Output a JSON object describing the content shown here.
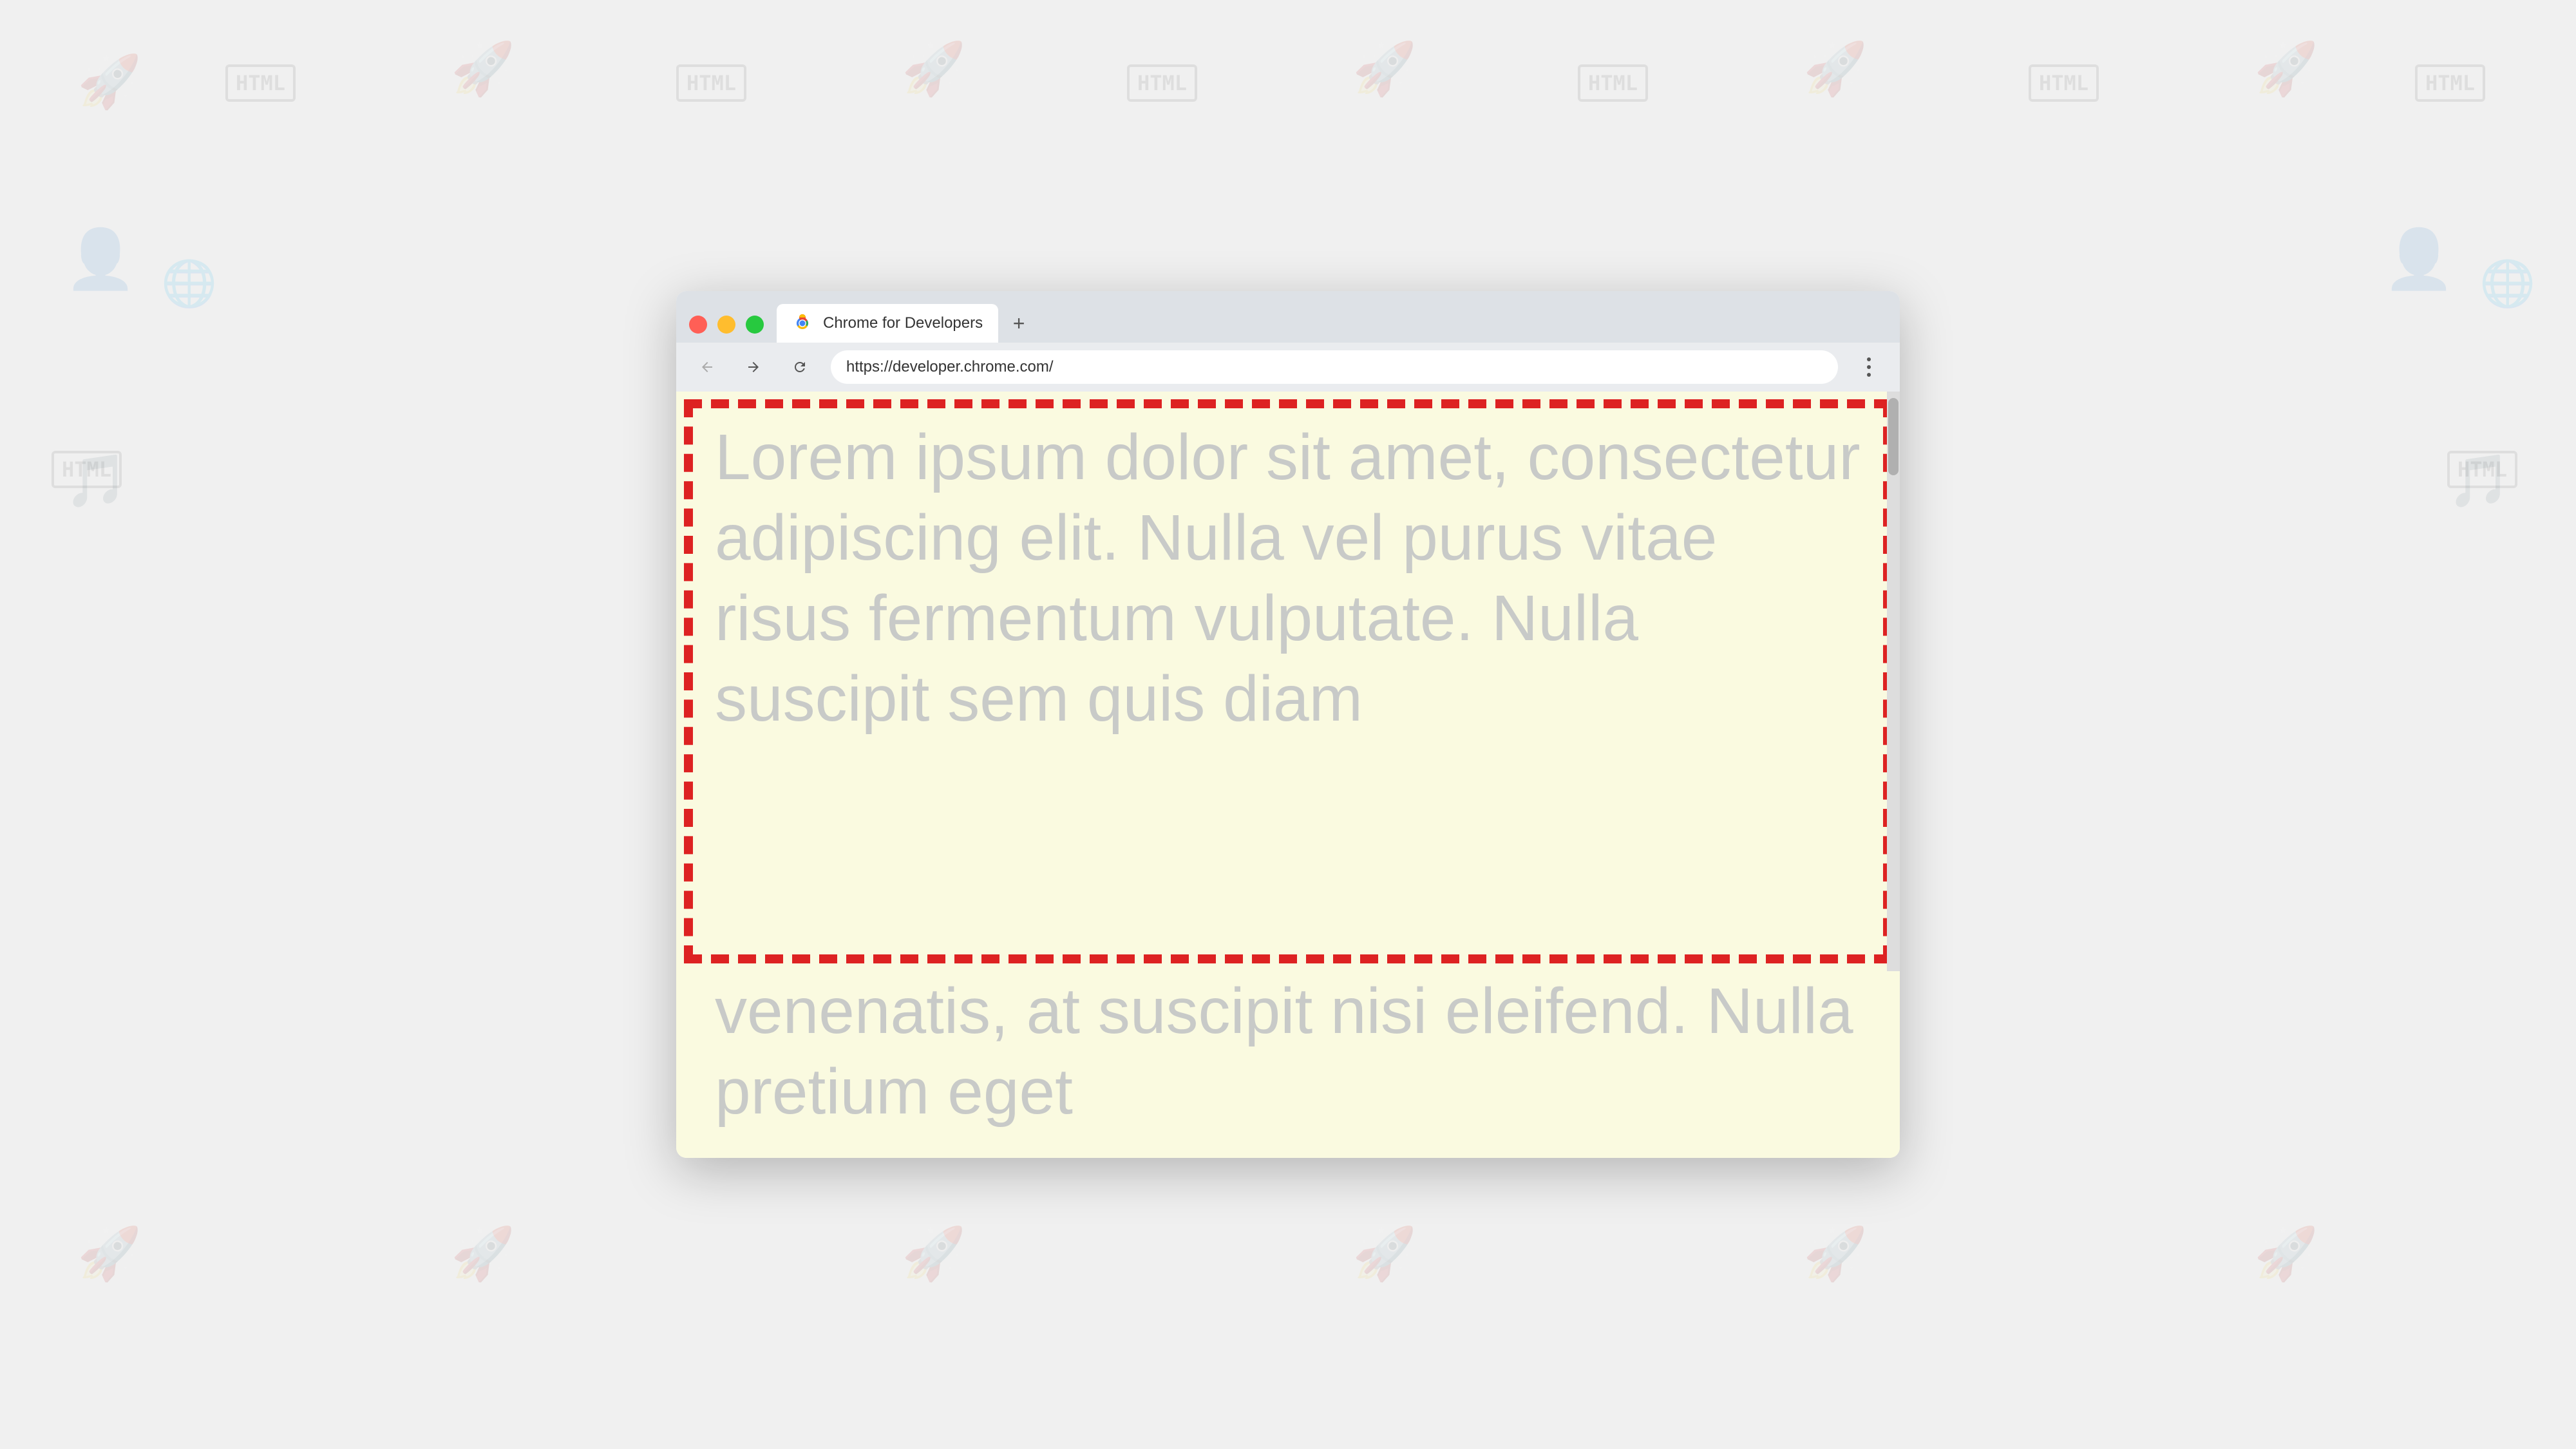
{
  "browser": {
    "tab": {
      "title": "Chrome for Developers",
      "url": "https://developer.chrome.com/",
      "favicon_alt": "Chrome logo"
    },
    "new_tab_label": "+",
    "nav": {
      "back_label": "←",
      "forward_label": "→",
      "refresh_label": "↻"
    },
    "menu_label": "⋮"
  },
  "page": {
    "lorem_text": "Lorem ipsum dolor sit amet, consectetur adipiscing elit. Nulla vel purus vitae risus fermentum vulputate. Nulla suscipit sem quis diam venenatis, at suscipit nisi eleifend. Nulla pretium eget",
    "below_fold_text": "venenatis, at suscipit nisi eleifend. Nulla pretium eget",
    "background_color": "#fafae0",
    "border_color": "#dd2222"
  },
  "background_icons": {
    "html_label": "HTML"
  }
}
